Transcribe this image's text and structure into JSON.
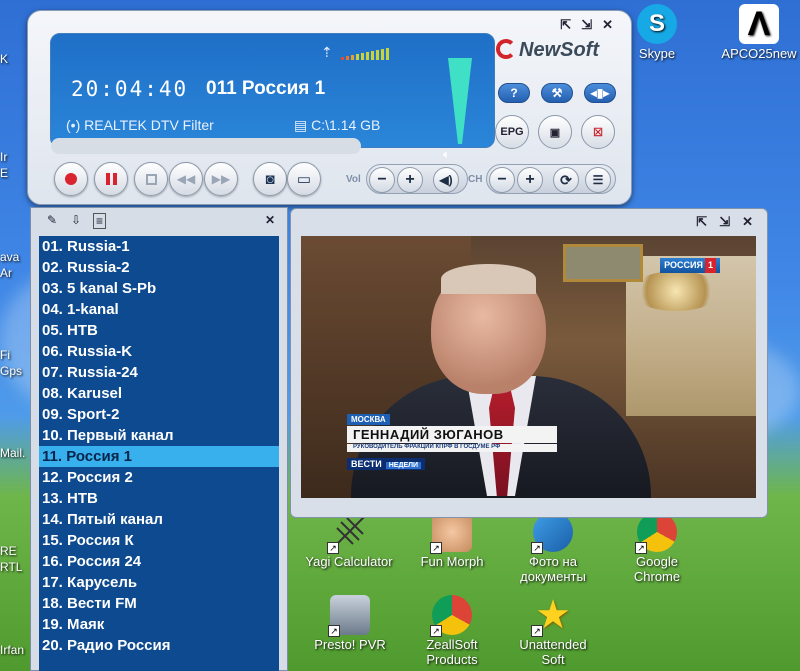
{
  "player": {
    "time": "20:04:40",
    "channel": "011 Россия 1",
    "filter_label": "REALTEK DTV Filter",
    "disk_label": "C:\\1.14 GB",
    "logo": "NewSoft",
    "vol_label": "Vol",
    "ch_label": "CH",
    "help_button": "?",
    "epg_button": "EPG",
    "window_controls": [
      "⇱",
      "⇲",
      "✕"
    ]
  },
  "playlist": {
    "items": [
      "01.  Russia-1",
      "02.  Russia-2",
      "03.  5 kanal S-Pb",
      "04.  1-kanal",
      "05.  HTB",
      "06.  Russia-K",
      "07.  Russia-24",
      "08.  Karusel",
      "09.  Sport-2",
      "10.  Первый канал",
      "11.  Россия 1",
      "12.  Россия 2",
      "13.  HTB",
      "14.  Пятый канал",
      "15.  Россия К",
      "16.  Россия 24",
      "17.  Карусель",
      "18.  Вести FM",
      "19.  Маяк",
      "20.  Радио Россия"
    ],
    "selected_index": 10
  },
  "video": {
    "channel_badge": "РОССИЯ",
    "channel_badge_num": "1",
    "caption_city": "МОСКВА",
    "caption_name": "ГЕННАДИЙ ЗЮГАНОВ",
    "caption_title": "РУКОВОДИТЕЛЬ ФРАКЦИИ КПРФ В ГОСДУМЕ РФ",
    "caption_show": "ВЕСТИ",
    "caption_show_sub": "НЕДЕЛИ"
  },
  "desktop": {
    "icons": [
      {
        "label": "Skype"
      },
      {
        "label": "APCO25new"
      },
      {
        "label": "Yagi Calculator"
      },
      {
        "label": "Fun Morph"
      },
      {
        "label": "Фото на документы"
      },
      {
        "label": "Google Chrome"
      },
      {
        "label": "Presto! PVR"
      },
      {
        "label": "ZeallSoft Products"
      },
      {
        "label": "Unattended Soft"
      }
    ],
    "left_labels": [
      "K",
      "Ir",
      "E",
      "ava",
      "Ar",
      "Fi",
      "Gps",
      "Mail.",
      "RE",
      "RTL",
      "Irfan"
    ]
  },
  "colors": {
    "display_blue": "#2a86d9",
    "playlist_bg": "#0e4a8f",
    "playlist_selected": "#39b0ee",
    "record_red": "#d9232e"
  }
}
